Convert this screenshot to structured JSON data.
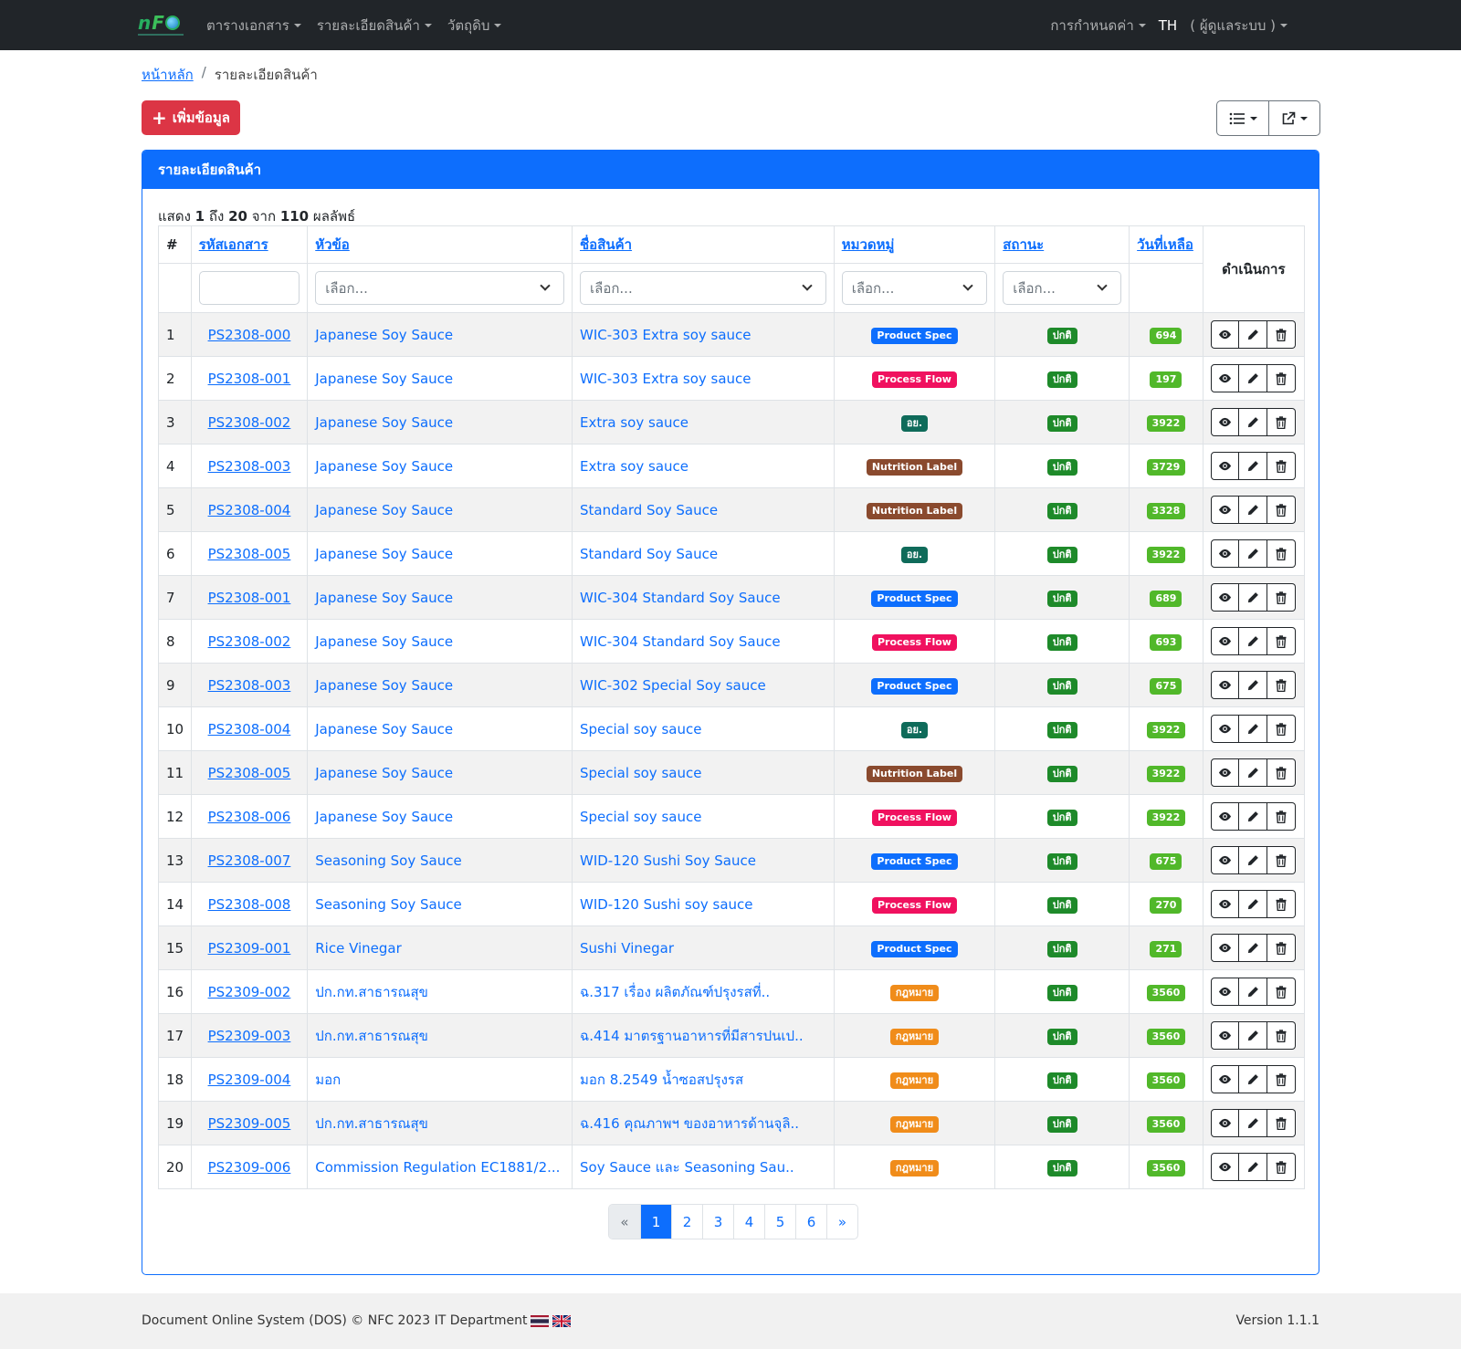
{
  "nav": {
    "left": [
      "ตารางเอกสาร",
      "รายละเอียดสินค้า",
      "วัตถุดิบ"
    ],
    "settings": "การกำหนดค่า",
    "lang": "TH",
    "user": "( ผู้ดูแลระบบ )"
  },
  "breadcrumb": {
    "home": "หน้าหลัก",
    "sep": "/",
    "current": "รายละเอียดสินค้า"
  },
  "add_button": "เพิ่มข้อมูล",
  "card_title": "รายละเอียดสินค้า",
  "summary": {
    "prefix": "แสดง",
    "from": "1",
    "to_word": "ถึง",
    "to": "20",
    "of_word": "จาก",
    "total": "110",
    "suffix": "ผลลัพธ์"
  },
  "columns": {
    "num": "#",
    "code": "รหัสเอกสาร",
    "subject": "หัวข้อ",
    "product": "ชื่อสินค้า",
    "category": "หมวดหมู่",
    "status": "สถานะ",
    "days": "วันที่เหลือ",
    "actions": "ดำเนินการ"
  },
  "filter_placeholder": "เลือก...",
  "badge_colors": {
    "Product Spec": "#0d6efd",
    "Process Flow": "#f0115f",
    "อย.": "#0f6b5a",
    "Nutrition Label": "#8a4a2e",
    "กฎหมาย": "#f08c1a",
    "status": "#1e8a2a",
    "days": "#51b82a"
  },
  "rows": [
    {
      "n": "1",
      "code": "PS2308-000",
      "subject": "Japanese Soy Sauce",
      "product": "WIC-303 Extra soy sauce",
      "category": "Product Spec",
      "status": "ปกติ",
      "days": "694"
    },
    {
      "n": "2",
      "code": "PS2308-001",
      "subject": "Japanese Soy Sauce",
      "product": "WIC-303 Extra soy sauce",
      "category": "Process Flow",
      "status": "ปกติ",
      "days": "197"
    },
    {
      "n": "3",
      "code": "PS2308-002",
      "subject": "Japanese Soy Sauce",
      "product": "Extra soy sauce",
      "category": "อย.",
      "status": "ปกติ",
      "days": "3922"
    },
    {
      "n": "4",
      "code": "PS2308-003",
      "subject": "Japanese Soy Sauce",
      "product": "Extra soy sauce",
      "category": "Nutrition Label",
      "status": "ปกติ",
      "days": "3729"
    },
    {
      "n": "5",
      "code": "PS2308-004",
      "subject": "Japanese Soy Sauce",
      "product": "Standard Soy Sauce",
      "category": "Nutrition Label",
      "status": "ปกติ",
      "days": "3328"
    },
    {
      "n": "6",
      "code": "PS2308-005",
      "subject": "Japanese Soy Sauce",
      "product": "Standard Soy Sauce",
      "category": "อย.",
      "status": "ปกติ",
      "days": "3922"
    },
    {
      "n": "7",
      "code": "PS2308-001",
      "subject": "Japanese Soy Sauce",
      "product": "WIC-304 Standard Soy Sauce",
      "category": "Product Spec",
      "status": "ปกติ",
      "days": "689"
    },
    {
      "n": "8",
      "code": "PS2308-002",
      "subject": "Japanese Soy Sauce",
      "product": "WIC-304 Standard Soy Sauce",
      "category": "Process Flow",
      "status": "ปกติ",
      "days": "693"
    },
    {
      "n": "9",
      "code": "PS2308-003",
      "subject": "Japanese Soy Sauce",
      "product": "WIC-302 Special Soy sauce",
      "category": "Product Spec",
      "status": "ปกติ",
      "days": "675"
    },
    {
      "n": "10",
      "code": "PS2308-004",
      "subject": "Japanese Soy Sauce",
      "product": "Special soy sauce",
      "category": "อย.",
      "status": "ปกติ",
      "days": "3922"
    },
    {
      "n": "11",
      "code": "PS2308-005",
      "subject": "Japanese Soy Sauce",
      "product": "Special soy sauce",
      "category": "Nutrition Label",
      "status": "ปกติ",
      "days": "3922"
    },
    {
      "n": "12",
      "code": "PS2308-006",
      "subject": "Japanese Soy Sauce",
      "product": "Special soy sauce",
      "category": "Process Flow",
      "status": "ปกติ",
      "days": "3922"
    },
    {
      "n": "13",
      "code": "PS2308-007",
      "subject": "Seasoning Soy Sauce",
      "product": "WID-120 Sushi Soy Sauce",
      "category": "Product Spec",
      "status": "ปกติ",
      "days": "675"
    },
    {
      "n": "14",
      "code": "PS2308-008",
      "subject": "Seasoning Soy Sauce",
      "product": "WID-120 Sushi soy sauce",
      "category": "Process Flow",
      "status": "ปกติ",
      "days": "270"
    },
    {
      "n": "15",
      "code": "PS2309-001",
      "subject": "Rice Vinegar",
      "product": "Sushi Vinegar",
      "category": "Product Spec",
      "status": "ปกติ",
      "days": "271"
    },
    {
      "n": "16",
      "code": "PS2309-002",
      "subject": "ปก.กท.สาธารณสุข",
      "product": "ฉ.317 เรื่อง ผลิตภัณฑ์ปรุงรสที่..",
      "category": "กฎหมาย",
      "status": "ปกติ",
      "days": "3560"
    },
    {
      "n": "17",
      "code": "PS2309-003",
      "subject": "ปก.กท.สาธารณสุข",
      "product": "ฉ.414 มาตรฐานอาหารที่มีสารปนเป..",
      "category": "กฎหมาย",
      "status": "ปกติ",
      "days": "3560"
    },
    {
      "n": "18",
      "code": "PS2309-004",
      "subject": "มอก",
      "product": "มอก 8.2549 น้ำซอสปรุงรส",
      "category": "กฎหมาย",
      "status": "ปกติ",
      "days": "3560"
    },
    {
      "n": "19",
      "code": "PS2309-005",
      "subject": "ปก.กท.สาธารณสุข",
      "product": "ฉ.416 คุณภาพฯ ของอาหารด้านจุลิ..",
      "category": "กฎหมาย",
      "status": "ปกติ",
      "days": "3560"
    },
    {
      "n": "20",
      "code": "PS2309-006",
      "subject": "Commission Regulation EC1881/2...",
      "product": "Soy Sauce และ Seasoning Sau..",
      "category": "กฎหมาย",
      "status": "ปกติ",
      "days": "3560"
    }
  ],
  "pagination": {
    "prev": "«",
    "pages": [
      "1",
      "2",
      "3",
      "4",
      "5",
      "6"
    ],
    "next": "»",
    "current": "1"
  },
  "footer": {
    "left": "Document Online System (DOS) © NFC 2023  IT Department",
    "right": "Version 1.1.1"
  }
}
